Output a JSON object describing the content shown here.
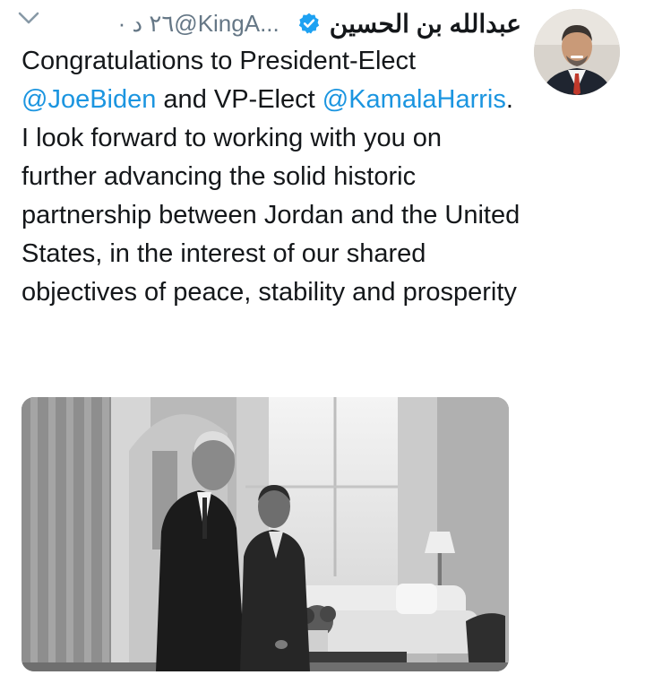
{
  "tweet": {
    "author_name": "عبدالله بن الحسين",
    "handle": "@KingA...",
    "separator": "·",
    "time": "٢٦ د",
    "text_before": "Congratulations to President-Elect ",
    "mention_1": "@JoeBiden",
    "text_middle": " and VP-Elect ",
    "mention_2": "@KamalaHarris",
    "text_after": ". I look forward to working with you on further advancing the solid historic partnership between Jordan and the United States, in the interest of our shared objectives of peace, stability and prosperity"
  },
  "colors": {
    "text": "#14171a",
    "secondary": "#657786",
    "link": "#1b95e0",
    "verified": "#1da1f2"
  },
  "icons": {
    "menu": "chevron-down-icon",
    "verified": "verified-badge-icon"
  }
}
